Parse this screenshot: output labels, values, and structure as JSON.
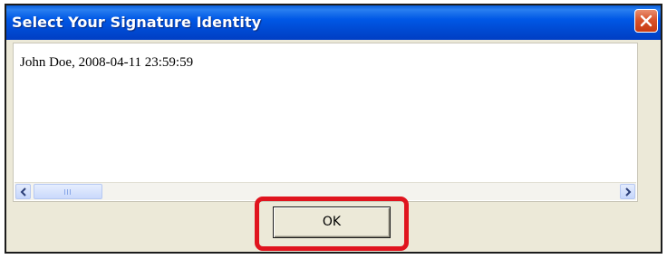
{
  "dialog": {
    "title": "Select Your Signature Identity",
    "close_icon": "close-icon",
    "identities": [
      "John Doe, 2008-04-11 23:59:59"
    ],
    "scrollbar": {
      "left_arrow_icon": "chevron-left-icon",
      "right_arrow_icon": "chevron-right-icon"
    },
    "ok_label": "OK",
    "highlight_color": "#e0141e",
    "titlebar_color": "#0058e6"
  }
}
